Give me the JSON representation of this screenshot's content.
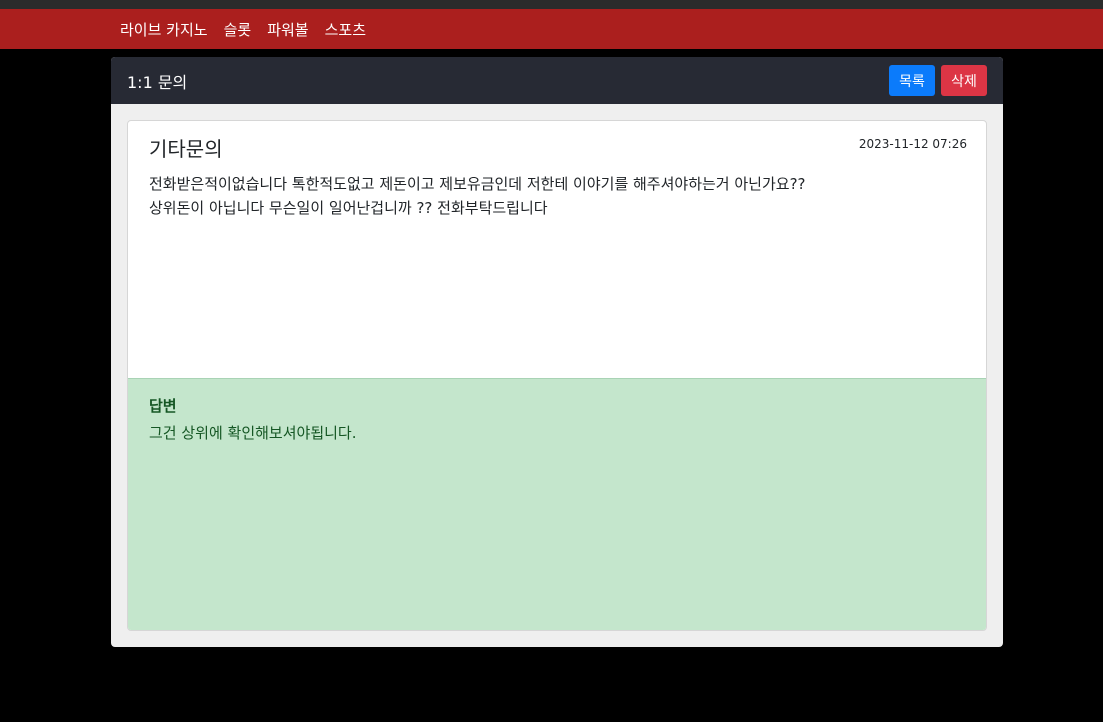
{
  "nav": {
    "items": [
      {
        "label": "라이브 카지노"
      },
      {
        "label": "슬롯"
      },
      {
        "label": "파워볼"
      },
      {
        "label": "스포츠"
      }
    ]
  },
  "panel": {
    "title": "1:1 문의",
    "list_button": "목록",
    "delete_button": "삭제"
  },
  "question": {
    "title": "기타문의",
    "date": "2023-11-12 07:26",
    "body": "전화받은적이없습니다 톡한적도없고 제돈이고 제보유금인데 저한테 이야기를 해주셔야하는거 아닌가요??\n상위돈이 아닙니다 무슨일이 일어난겁니까 ?? 전화부탁드립니다"
  },
  "answer": {
    "title": "답변",
    "body": "그건 상위에 확인해보셔야됩니다."
  },
  "colors": {
    "navbar": "#ab1f1e",
    "header": "#272a34",
    "list_button": "#0b7bfb",
    "delete_button": "#dc3545",
    "answer_bg": "#c4e6cc"
  }
}
